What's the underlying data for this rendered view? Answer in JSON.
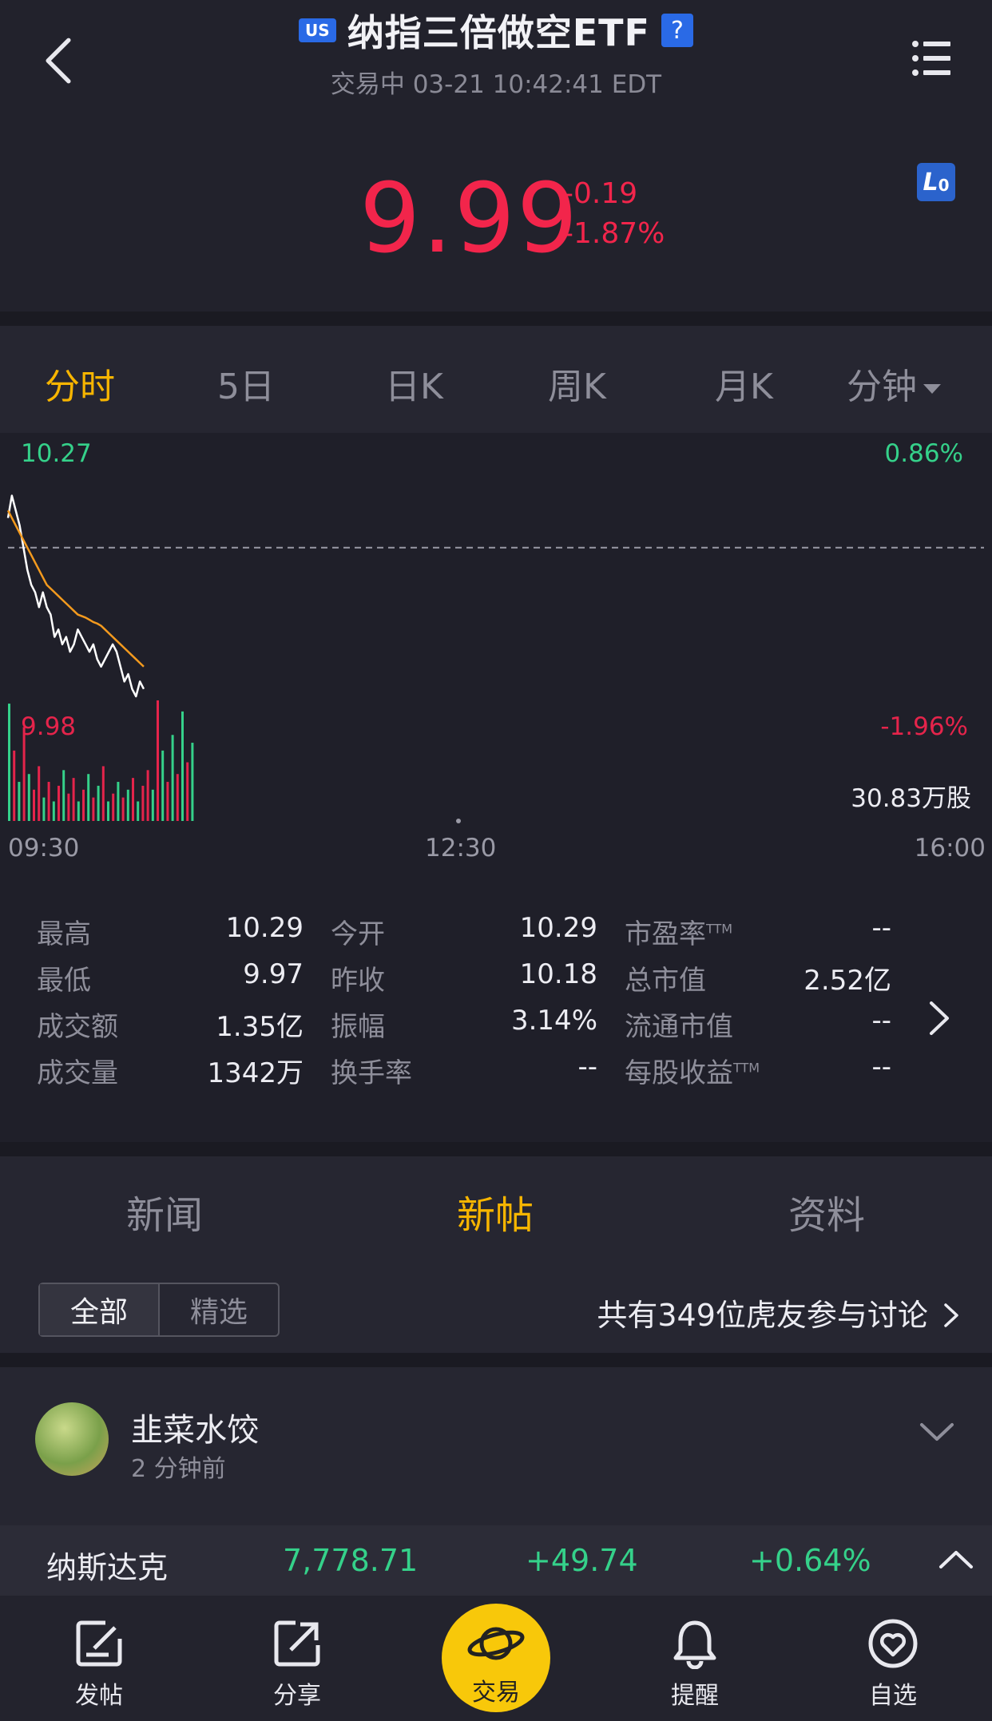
{
  "header": {
    "market_badge": "US",
    "title": "纳指三倍做空ETF",
    "help": "?",
    "status": "交易中 03-21 10:42:41 EDT",
    "price": "9.99",
    "change_abs": "-0.19",
    "change_pct": "-1.87%",
    "level_badge": "L",
    "level_badge_num": "0"
  },
  "chart_tabs": [
    {
      "label": "分时",
      "active": true
    },
    {
      "label": "5日"
    },
    {
      "label": "日K"
    },
    {
      "label": "周K"
    },
    {
      "label": "月K"
    },
    {
      "label": "分钟"
    }
  ],
  "chart_labels": {
    "price_high": "10.27",
    "price_low": "9.98",
    "pct_high": "0.86%",
    "pct_low": "-1.96%",
    "volume": "30.83万股",
    "time_start": "09:30",
    "time_mid": "12:30",
    "time_end": "16:00"
  },
  "chart_data": {
    "type": "line",
    "title": "",
    "xlabel": "",
    "ylabel": "",
    "x_range": [
      "09:30",
      "16:00"
    ],
    "ylim": [
      9.98,
      10.27
    ],
    "prev_close": 10.18,
    "series": [
      {
        "values": [
          10.22,
          10.25,
          10.23,
          10.21,
          10.18,
          10.15,
          10.13,
          10.12,
          10.1,
          10.12,
          10.1,
          10.09,
          10.06,
          10.07,
          10.05,
          10.06,
          10.04,
          10.05,
          10.07,
          10.06,
          10.05,
          10.04,
          10.05,
          10.03,
          10.02,
          10.03,
          10.04,
          10.05,
          10.04,
          10.02,
          10.0,
          10.01,
          9.99,
          9.98,
          10.0,
          9.99
        ]
      },
      {
        "values": [
          10.23,
          10.22,
          10.21,
          10.2,
          10.19,
          10.18,
          10.17,
          10.16,
          10.15,
          10.14,
          10.13,
          10.125,
          10.12,
          10.115,
          10.11,
          10.105,
          10.1,
          10.095,
          10.09,
          10.088,
          10.086,
          10.083,
          10.08,
          10.078,
          10.075,
          10.07,
          10.065,
          10.06,
          10.055,
          10.05,
          10.045,
          10.04,
          10.035,
          10.03,
          10.025,
          10.02
        ]
      }
    ],
    "volume_max": 30.83,
    "volume_unit": "万股",
    "volume": [
      {
        "v": 30,
        "c": "up"
      },
      {
        "v": 18,
        "c": "down"
      },
      {
        "v": 10,
        "c": "up"
      },
      {
        "v": 24,
        "c": "down"
      },
      {
        "v": 12,
        "c": "up"
      },
      {
        "v": 8,
        "c": "down"
      },
      {
        "v": 14,
        "c": "down"
      },
      {
        "v": 6,
        "c": "up"
      },
      {
        "v": 10,
        "c": "down"
      },
      {
        "v": 5,
        "c": "up"
      },
      {
        "v": 9,
        "c": "down"
      },
      {
        "v": 13,
        "c": "up"
      },
      {
        "v": 7,
        "c": "down"
      },
      {
        "v": 11,
        "c": "down"
      },
      {
        "v": 5,
        "c": "up"
      },
      {
        "v": 8,
        "c": "down"
      },
      {
        "v": 12,
        "c": "up"
      },
      {
        "v": 6,
        "c": "down"
      },
      {
        "v": 9,
        "c": "up"
      },
      {
        "v": 14,
        "c": "down"
      },
      {
        "v": 5,
        "c": "up"
      },
      {
        "v": 7,
        "c": "down"
      },
      {
        "v": 10,
        "c": "up"
      },
      {
        "v": 6,
        "c": "down"
      },
      {
        "v": 8,
        "c": "up"
      },
      {
        "v": 11,
        "c": "down"
      },
      {
        "v": 5,
        "c": "up"
      },
      {
        "v": 9,
        "c": "down"
      },
      {
        "v": 13,
        "c": "down"
      },
      {
        "v": 8,
        "c": "up"
      },
      {
        "v": 30.83,
        "c": "down"
      },
      {
        "v": 18,
        "c": "up"
      },
      {
        "v": 10,
        "c": "down"
      },
      {
        "v": 22,
        "c": "up"
      },
      {
        "v": 12,
        "c": "down"
      },
      {
        "v": 28,
        "c": "up"
      },
      {
        "v": 15,
        "c": "down"
      },
      {
        "v": 20,
        "c": "up"
      }
    ],
    "colors": {
      "price": "#ffffff",
      "avg": "#f39a1e",
      "up": "#35d18a",
      "down": "#e5244b",
      "grid": "#9a9aa6"
    }
  },
  "stats": {
    "rows": [
      [
        {
          "label": "最高",
          "value": "10.29"
        },
        {
          "label": "今开",
          "value": "10.29"
        },
        {
          "label": "市盈率",
          "sup": "TTM",
          "value": "--"
        }
      ],
      [
        {
          "label": "最低",
          "value": "9.97"
        },
        {
          "label": "昨收",
          "value": "10.18"
        },
        {
          "label": "总市值",
          "value": "2.52亿"
        }
      ],
      [
        {
          "label": "成交额",
          "value": "1.35亿"
        },
        {
          "label": "振幅",
          "value": "3.14%"
        },
        {
          "label": "流通市值",
          "value": "--"
        }
      ],
      [
        {
          "label": "成交量",
          "value": "1342万"
        },
        {
          "label": "换手率",
          "value": "--"
        },
        {
          "label": "每股收益",
          "sup": "TTM",
          "value": "--"
        }
      ]
    ]
  },
  "content_tabs": [
    {
      "label": "新闻"
    },
    {
      "label": "新帖",
      "active": true
    },
    {
      "label": "资料"
    }
  ],
  "filter": {
    "all": "全部",
    "featured": "精选",
    "discussion": "共有349位虎友参与讨论"
  },
  "post": {
    "username": "韭菜水饺",
    "time": "2 分钟前"
  },
  "market_bar": {
    "name": "纳斯达克",
    "value": "7,778.71",
    "change": "+49.74",
    "change_pct": "+0.64%"
  },
  "bottom_nav": {
    "post": "发帖",
    "share": "分享",
    "trade": "交易",
    "alert": "提醒",
    "watchlist": "自选"
  },
  "colors": {
    "accent": "#f7b500",
    "down": "#f2254b",
    "up": "#35d18a",
    "background": "#1f1f29"
  }
}
